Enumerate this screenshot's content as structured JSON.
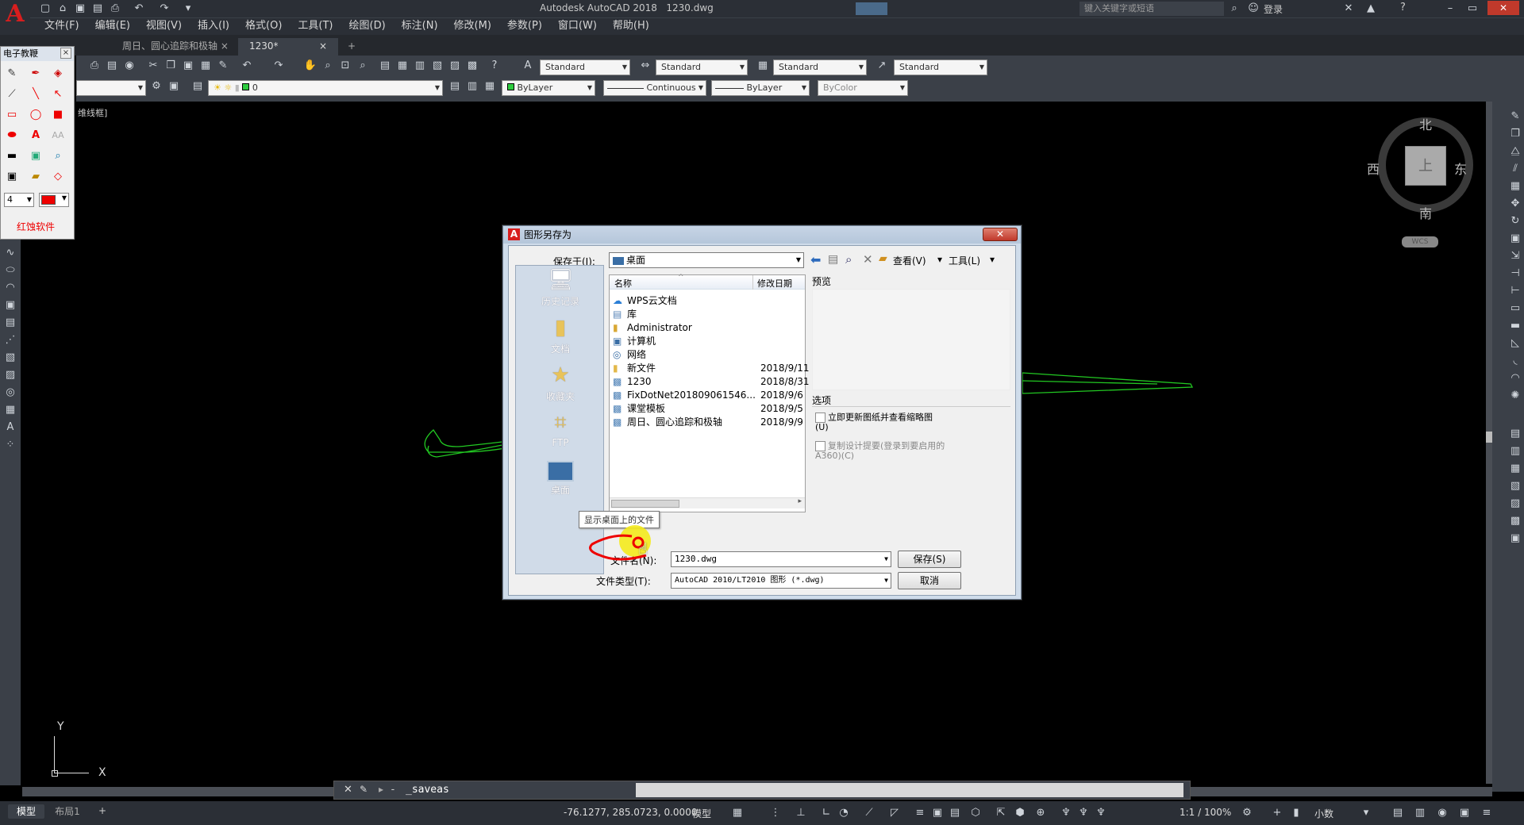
{
  "app": {
    "title": "Autodesk AutoCAD 2018",
    "document": "1230.dwg",
    "search_placeholder": "键入关键字或短语",
    "login": "登录",
    "help": "?"
  },
  "menu": [
    "文件(F)",
    "编辑(E)",
    "视图(V)",
    "插入(I)",
    "格式(O)",
    "工具(T)",
    "绘图(D)",
    "标注(N)",
    "修改(M)",
    "参数(P)",
    "窗口(W)",
    "帮助(H)"
  ],
  "tabs": [
    "周日、圆心追踪和极轴",
    "1230*"
  ],
  "toolbar": {
    "style1": "Standard",
    "style2": "Standard",
    "style3": "Standard",
    "style4": "Standard",
    "layer": "0",
    "color": "ByLayer",
    "linetype": "Continuous",
    "lineweight": "ByLayer",
    "plotstyle": "ByColor"
  },
  "viewport_label": "维线框]",
  "panel": {
    "title": "电子教鞭",
    "size_value": "4",
    "brand": "红蚀软件"
  },
  "viewcube": {
    "north": "北",
    "south": "南",
    "east": "东",
    "west": "西",
    "top": "上",
    "wcs": "WCS"
  },
  "axis": {
    "y": "Y",
    "x": "X"
  },
  "dialog": {
    "title": "图形另存为",
    "save_in_label": "保存于(I):",
    "save_in_value": "桌面",
    "view_label": "查看(V)",
    "tools_label": "工具(L)",
    "col_name": "名称",
    "col_date": "修改日期",
    "preview_label": "预览",
    "options_label": "选项",
    "opt1": "立即更新图纸并查看缩略图(U)",
    "opt2": "复制设计提要(登录到要启用的A360)(C)",
    "filename_label": "文件名(N):",
    "filename_value": "1230.dwg",
    "filetype_label": "文件类型(T):",
    "filetype_value": "AutoCAD 2010/LT2010 图形 (*.dwg)",
    "save_button": "保存(S)",
    "cancel_button": "取消",
    "tooltip": "显示桌面上的文件",
    "places": [
      "历史记录",
      "文档",
      "收藏夹",
      "FTP",
      "桌面"
    ],
    "files": [
      {
        "name": "WPS云文档",
        "date": "",
        "icon": "cloud"
      },
      {
        "name": "库",
        "date": "",
        "icon": "library"
      },
      {
        "name": "Administrator",
        "date": "",
        "icon": "user-folder"
      },
      {
        "name": "计算机",
        "date": "",
        "icon": "computer"
      },
      {
        "name": "网络",
        "date": "",
        "icon": "network"
      },
      {
        "name": "新文件",
        "date": "2018/9/11",
        "icon": "folder"
      },
      {
        "name": "1230",
        "date": "2018/8/31",
        "icon": "dwg"
      },
      {
        "name": "FixDotNet201809061546...",
        "date": "2018/9/6",
        "icon": "dwg"
      },
      {
        "name": "课堂模板",
        "date": "2018/9/5",
        "icon": "dwg"
      },
      {
        "name": "周日、圆心追踪和极轴",
        "date": "2018/9/9",
        "icon": "dwg"
      }
    ]
  },
  "command": {
    "text": "_saveas",
    "prompt": "- "
  },
  "layout_tabs": [
    "模型",
    "布局1"
  ],
  "status": {
    "coords": "-76.1277, 285.0723, 0.0000",
    "model": "模型",
    "scale": "1:1 / 100%",
    "units": "小数"
  }
}
